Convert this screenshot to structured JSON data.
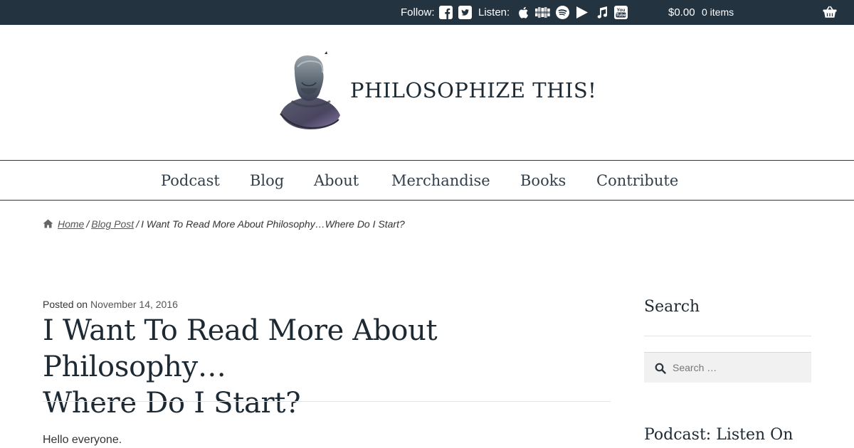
{
  "topbar": {
    "follow_label": "Follow:",
    "listen_label": "Listen:",
    "follow_icons": [
      "facebook-icon",
      "twitter-icon"
    ],
    "listen_icons": [
      "apple-podcasts-icon",
      "stitcher-icon",
      "spotify-icon",
      "google-play-icon",
      "itunes-music-icon",
      "youtube-icon"
    ],
    "cart_amount": "$0.00",
    "cart_items": "0 items",
    "background_color": "#243340"
  },
  "header": {
    "site_title": "PHILOSOPHIZE THIS!"
  },
  "nav": {
    "items": [
      "Podcast",
      "Blog",
      "About",
      "Merchandise",
      "Books",
      "Contribute"
    ]
  },
  "breadcrumb": {
    "home": "Home",
    "category": "Blog Post",
    "current": "I Want To Read More About Philosophy…Where Do I Start?"
  },
  "post": {
    "posted_on_label": "Posted on",
    "date": "November 14, 2016",
    "title_line1": "I Want To Read More About Philosophy…",
    "title_line2": "Where Do I Start?",
    "first_paragraph": "Hello everyone."
  },
  "sidebar": {
    "search_heading": "Search",
    "search_placeholder": "Search …",
    "podcast_heading": "Podcast: Listen On"
  }
}
